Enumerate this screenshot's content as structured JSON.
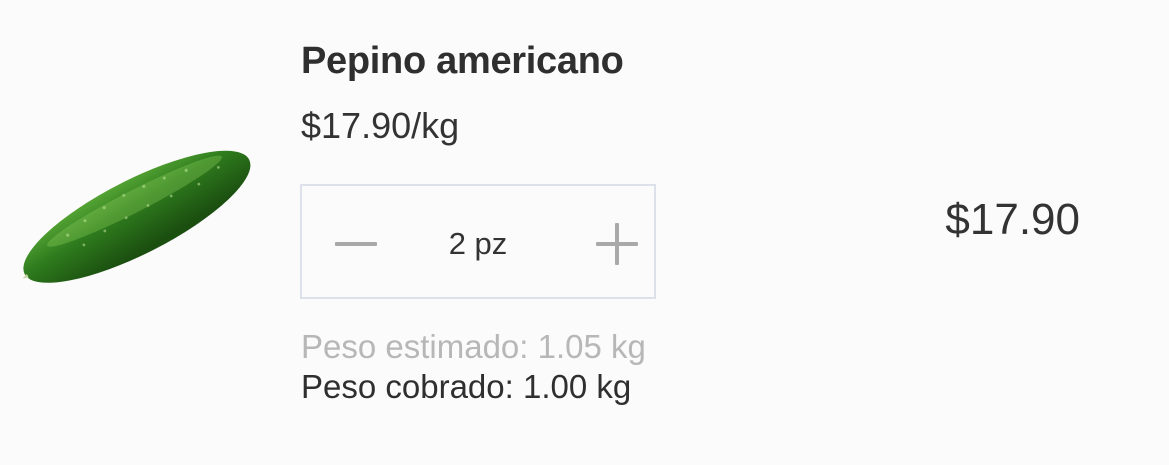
{
  "product": {
    "name": "Pepino americano",
    "unit_price": "$17.90/kg",
    "image_icon": "cucumber-image"
  },
  "quantity": {
    "value": "2 pz",
    "decrement_icon": "minus-icon",
    "increment_icon": "plus-icon"
  },
  "weights": {
    "estimated": "Peso estimado: 1.05 kg",
    "charged": "Peso cobrado: 1.00 kg"
  },
  "total": "$17.90",
  "colors": {
    "background": "#fbfbfc",
    "text": "#333333",
    "muted_text": "#b7b7b7",
    "stepper_border": "#dde1ea",
    "stepper_icon": "#a9a9a9",
    "cucumber_green": "#2f7a1f"
  }
}
